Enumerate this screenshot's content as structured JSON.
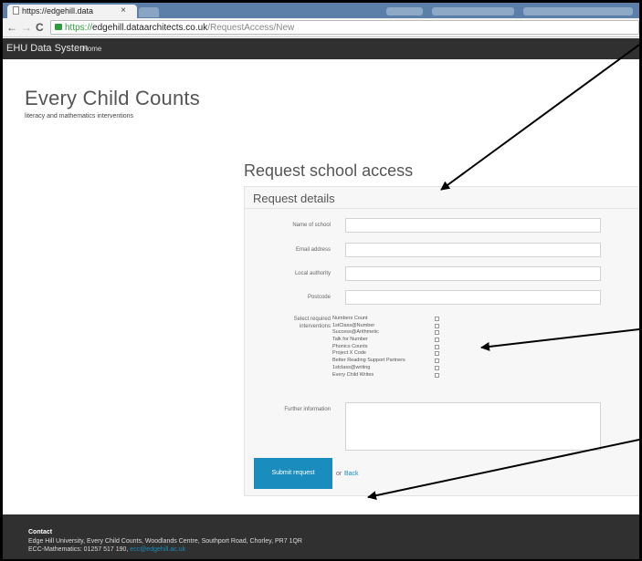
{
  "browser": {
    "tab_title": "https://edgehill.data",
    "tab_close": "×",
    "url_scheme": "https://",
    "url_host": "edgehill.dataarchitects.co.uk",
    "url_path": "/RequestAccess/New"
  },
  "appnav": {
    "brand": "EHU Data System",
    "home": "Home"
  },
  "hero": {
    "title": "Every Child Counts",
    "subtitle": "literacy and mathematics interventions"
  },
  "form": {
    "heading": "Request school access",
    "panel_title": "Request details",
    "fields": {
      "school_label": "Name of school",
      "email_label": "Email address",
      "authority_label": "Local authority",
      "postcode_label": "Postcode",
      "interventions_label_1": "Select required",
      "interventions_label_2": "interventions",
      "further_label": "Further information"
    },
    "interventions": [
      "Numbers Count",
      "1stClass@Number",
      "Success@Arithmetic",
      "Talk for Number",
      "Phonics Counts",
      "Project X Code",
      "Better Reading Support Partners",
      "1stclass@writing",
      "Every Child Writes"
    ],
    "submit": "Submit request",
    "or": "or",
    "back": "Back"
  },
  "footer": {
    "heading": "Contact",
    "address": "Edge Hill University, Every Child Counts, Woodlands Centre, Southport Road, Chorley, PR7 1QR",
    "phone": "ECC-Mathematics: 01257 517 190,",
    "email": "ecc@edgehill.ac.uk"
  },
  "colors": {
    "nav_bg": "#303030",
    "accent": "#1b8cbe",
    "annotation": "#000000"
  }
}
